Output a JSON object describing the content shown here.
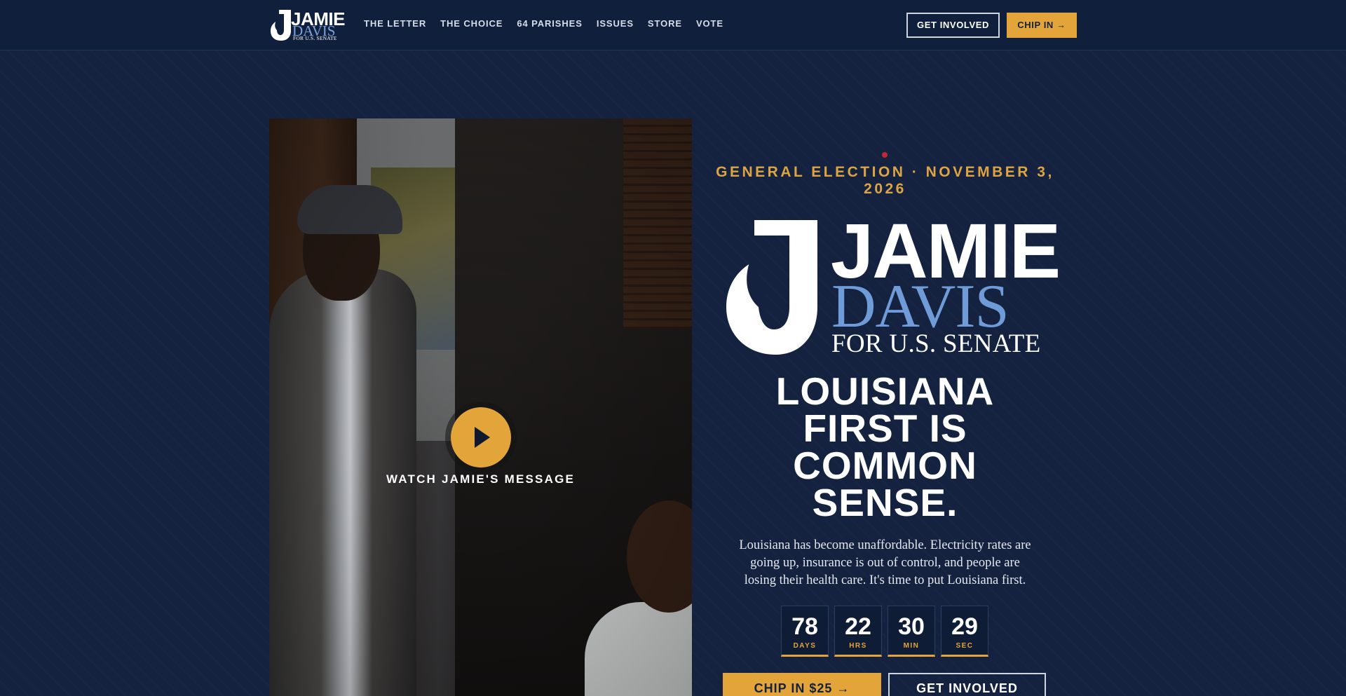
{
  "nav": {
    "logo": {
      "name": "JAMIE",
      "surname": "DAVIS",
      "office": "FOR U.S. SENATE"
    },
    "items": [
      "THE LETTER",
      "THE CHOICE",
      "64 PARISHES",
      "ISSUES",
      "STORE",
      "VOTE"
    ],
    "get_involved": "GET INVOLVED",
    "chip_in": "CHIP IN →"
  },
  "video": {
    "caption": "WATCH JAMIE'S MESSAGE",
    "play_icon": "play-icon"
  },
  "hero": {
    "eyebrow": "GENERAL ELECTION · NOVEMBER 3, 2026",
    "logo": {
      "name": "JAMIE",
      "surname": "DAVIS",
      "office": "FOR U.S. SENATE"
    },
    "headline": "LOUISIANA FIRST IS COMMON SENSE.",
    "lede": "Louisiana has become unaffordable. Electricity rates are going up, insurance is out of control, and people are losing their health care. It's time to put Louisiana first.",
    "countdown": [
      {
        "value": "78",
        "label": "DAYS"
      },
      {
        "value": "22",
        "label": "HRS"
      },
      {
        "value": "30",
        "label": "MIN"
      },
      {
        "value": "29",
        "label": "SEC"
      }
    ],
    "cta_chip": "CHIP IN $25 →",
    "cta_involved": "GET INVOLVED"
  },
  "colors": {
    "background": "#142240",
    "accent": "#e3a539",
    "logo_blue": "#6f9bd8",
    "live_dot": "#c2273a"
  }
}
